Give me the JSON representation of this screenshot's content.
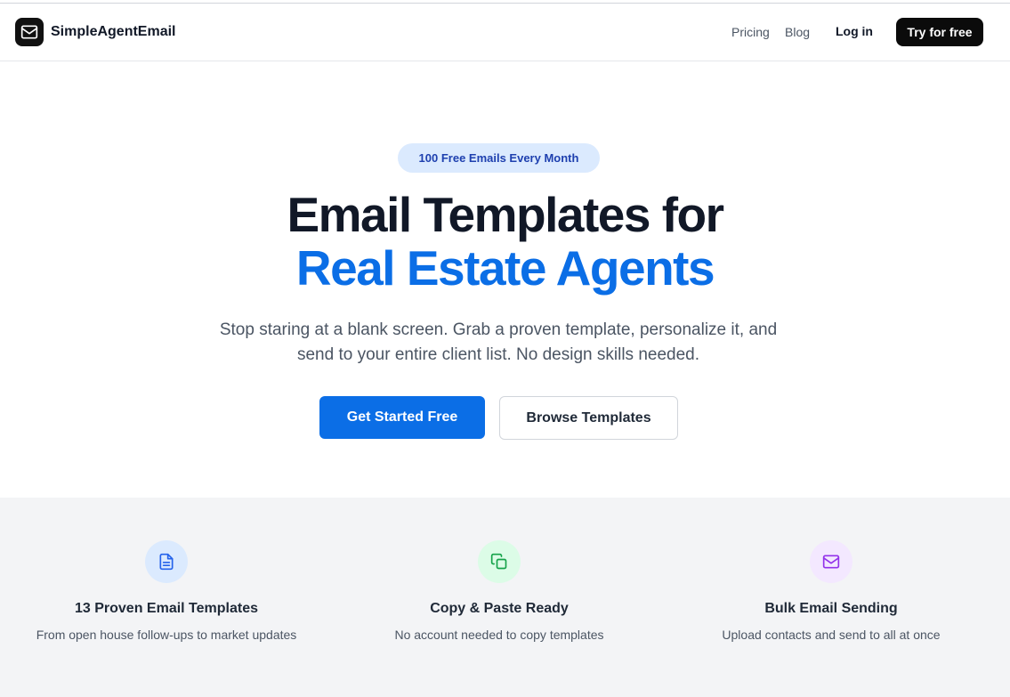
{
  "nav": {
    "brand": "SimpleAgentEmail",
    "links": [
      "Pricing",
      "Blog"
    ],
    "login": "Log in",
    "cta": "Try for free"
  },
  "hero": {
    "badge": "100 Free Emails Every Month",
    "title_line1": "Email Templates for",
    "title_line2": "Real Estate Agents",
    "subtitle": "Stop staring at a blank screen. Grab a proven template, personalize it, and send to your entire client list. No design skills needed.",
    "primary_button": "Get Started Free",
    "secondary_button": "Browse Templates"
  },
  "features": [
    {
      "icon": "document-icon",
      "title": "13 Proven Email Templates",
      "description": "From open house follow-ups to market updates",
      "color": "#2563eb",
      "bg": "#dbeafe"
    },
    {
      "icon": "copy-icon",
      "title": "Copy & Paste Ready",
      "description": "No account needed to copy templates",
      "color": "#16a34a",
      "bg": "#dcfce7"
    },
    {
      "icon": "mail-icon",
      "title": "Bulk Email Sending",
      "description": "Upload contacts and send to all at once",
      "color": "#9333ea",
      "bg": "#f3e8ff"
    }
  ],
  "colors": {
    "accent": "#0b6ee6",
    "badge_bg": "#dbeafe",
    "badge_text": "#1e40af",
    "dark_button": "#0b0b0b"
  }
}
